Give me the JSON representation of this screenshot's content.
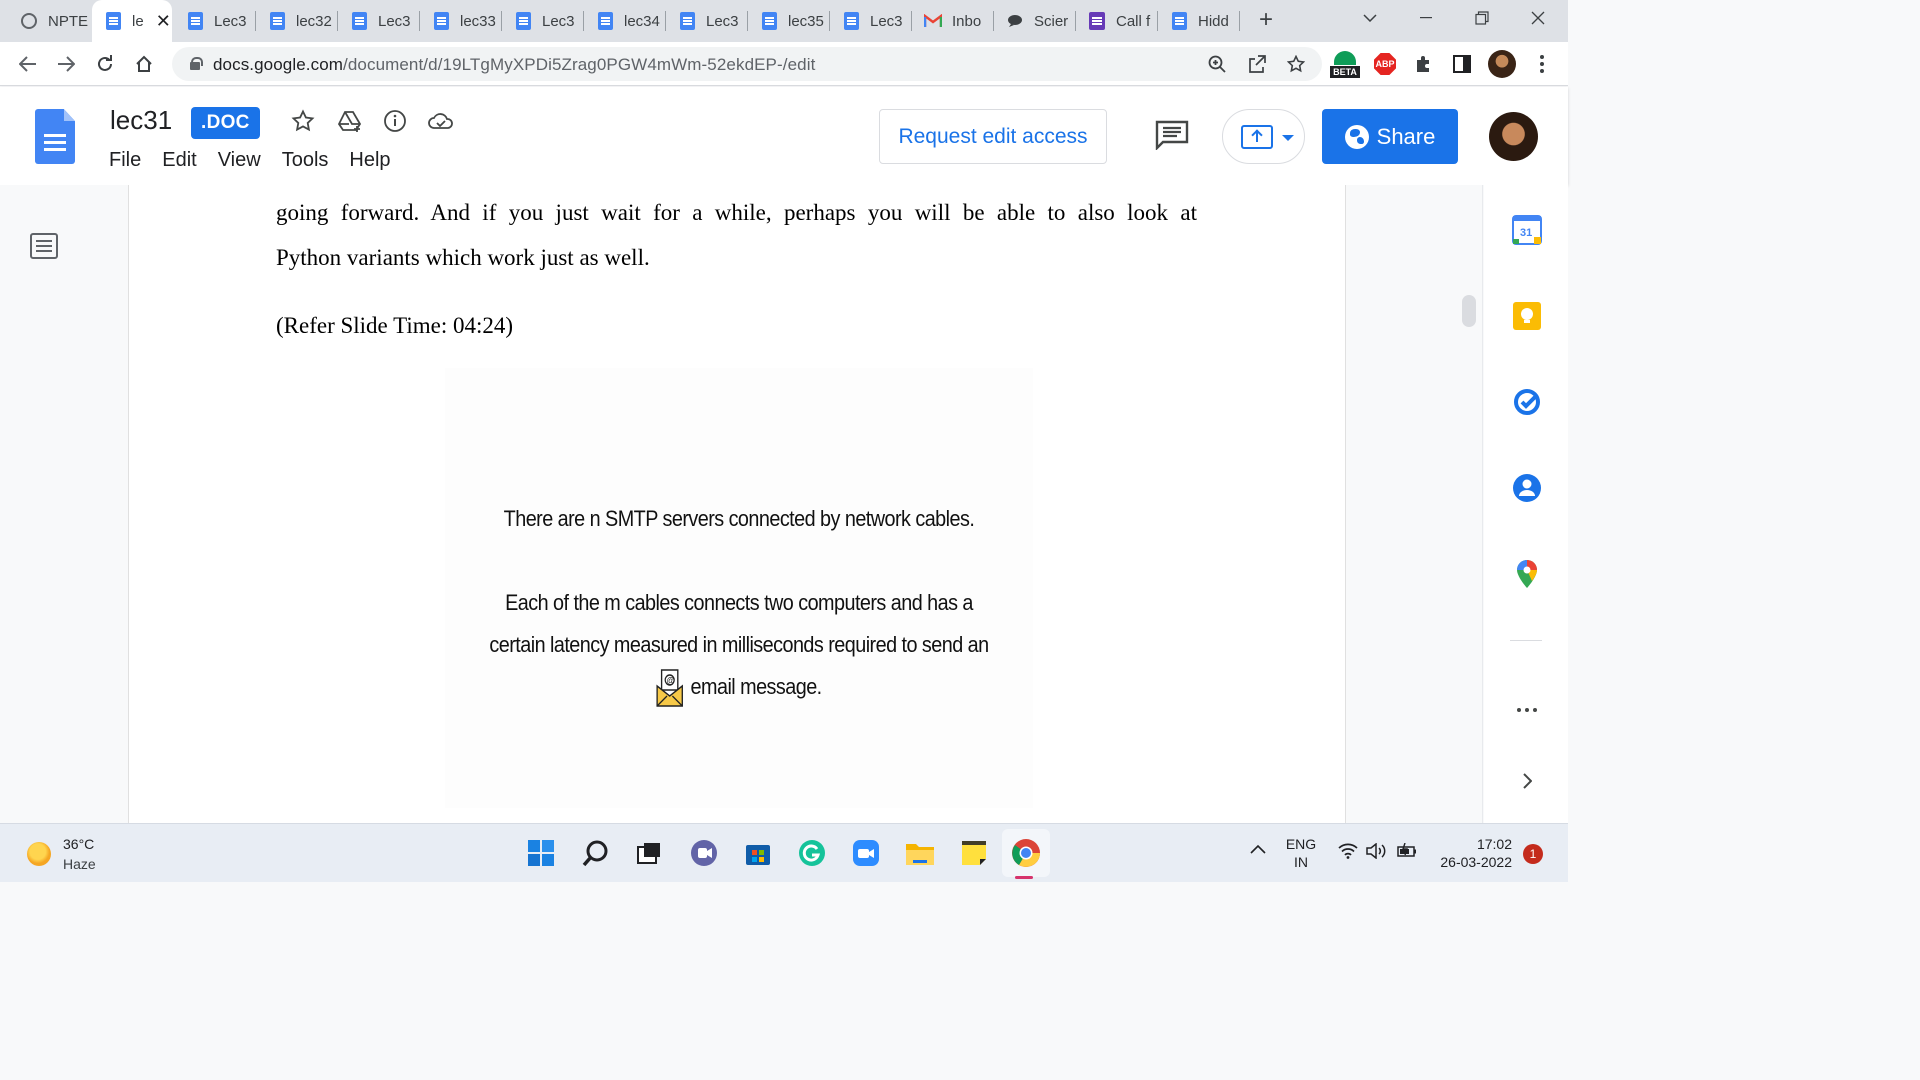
{
  "browser": {
    "tabs": [
      {
        "label": "NPTE",
        "icon": "globe-icon"
      },
      {
        "label": "le",
        "icon": "docs-icon",
        "active": true
      },
      {
        "label": "Lec3",
        "icon": "docs-icon"
      },
      {
        "label": "lec32",
        "icon": "docs-icon"
      },
      {
        "label": "Lec3",
        "icon": "docs-icon"
      },
      {
        "label": "lec33",
        "icon": "docs-icon"
      },
      {
        "label": "Lec3",
        "icon": "docs-icon"
      },
      {
        "label": "lec34",
        "icon": "docs-icon"
      },
      {
        "label": "Lec3",
        "icon": "docs-icon"
      },
      {
        "label": "lec35",
        "icon": "docs-icon"
      },
      {
        "label": "Lec3",
        "icon": "docs-icon"
      },
      {
        "label": "Inbo",
        "icon": "gmail-icon"
      },
      {
        "label": "Scier",
        "icon": "chat-icon"
      },
      {
        "label": "Call f",
        "icon": "forms-icon"
      },
      {
        "label": "Hidd",
        "icon": "docs-icon"
      }
    ],
    "url_host": "docs.google.com",
    "url_path": "/document/d/19LTgMyXPDi5Zrag0PGW4mWm-52ekdEP-/edit",
    "beta_label": "BETA",
    "abp_label": "ABP"
  },
  "docs": {
    "title": "lec31",
    "badge": ".DOC",
    "menu": [
      "File",
      "Edit",
      "View",
      "Tools",
      "Help"
    ],
    "request_access": "Request edit access",
    "share": "Share"
  },
  "document": {
    "para1_line1": "going forward. And if you just wait for a while, perhaps you will be able to also look at",
    "para1_line2": "Python variants which work just as well.",
    "para2": "(Refer Slide Time: 04:24)",
    "slide": {
      "line1": "There are n SMTP servers connected by network cables.",
      "line2": "Each of the m cables connects two computers and has a",
      "line3": "certain latency measured in milliseconds required to send an",
      "line4": "email message."
    }
  },
  "side_panel": {
    "calendar_day": "31"
  },
  "taskbar": {
    "temperature": "36°C",
    "weather": "Haze",
    "lang1": "ENG",
    "lang2": "IN",
    "time": "17:02",
    "date": "26-03-2022",
    "notifications": "1"
  },
  "colors": {
    "accent": "#1a73e8",
    "docs_blue": "#4285f4"
  }
}
